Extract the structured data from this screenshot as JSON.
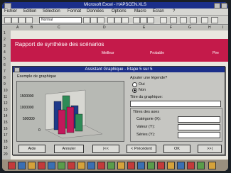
{
  "window": {
    "title": "Microsoft Excel - HAPSCEN.XLS"
  },
  "menu": {
    "items": [
      "Fichier",
      "Edition",
      "Sélection",
      "Format",
      "Données",
      "Options",
      "Macro",
      "Ecran",
      "?"
    ]
  },
  "toolbar": {
    "font": "Normal"
  },
  "columns": [
    "A",
    "B",
    "C",
    "D",
    "E",
    "F",
    "G",
    "H",
    "I"
  ],
  "rows": [
    "1",
    "2",
    "3",
    "4",
    "5",
    "6",
    "7",
    "8",
    "9",
    "10",
    "11",
    "12",
    "13",
    "14",
    "15",
    "16",
    "17",
    "18",
    "19",
    "20"
  ],
  "sheet": {
    "banner_title": "Rapport de synthèse des scénarios",
    "banner_headers": [
      "Meilleur",
      "Probable",
      "Pire"
    ]
  },
  "dialog": {
    "title": "Assistant Graphique - Etape 5 sur 5",
    "preview_label": "Exemple de graphique",
    "legend_question": "Ajouter une légende?",
    "legend_yes": "Oui",
    "legend_no": "Non",
    "chart_title_label": "Titre du graphique:",
    "axes_group_label": "Titres des axes",
    "category_label": "Catégorie (X):",
    "value_label": "Valeur (Y):",
    "series_label": "Séries (Y):",
    "legend_selected": "Non",
    "buttons": {
      "help": "Aide",
      "cancel": "Annuler",
      "first": "|<<",
      "previous": "< Précédent",
      "ok": "OK",
      "next": ">>|"
    }
  },
  "chart_data": {
    "type": "bar",
    "tick_labels": [
      "1500000",
      "1000000",
      "500000",
      "0"
    ],
    "series_colors": [
      "#1e3a8a",
      "#c2185b",
      "#2e8b57"
    ]
  }
}
